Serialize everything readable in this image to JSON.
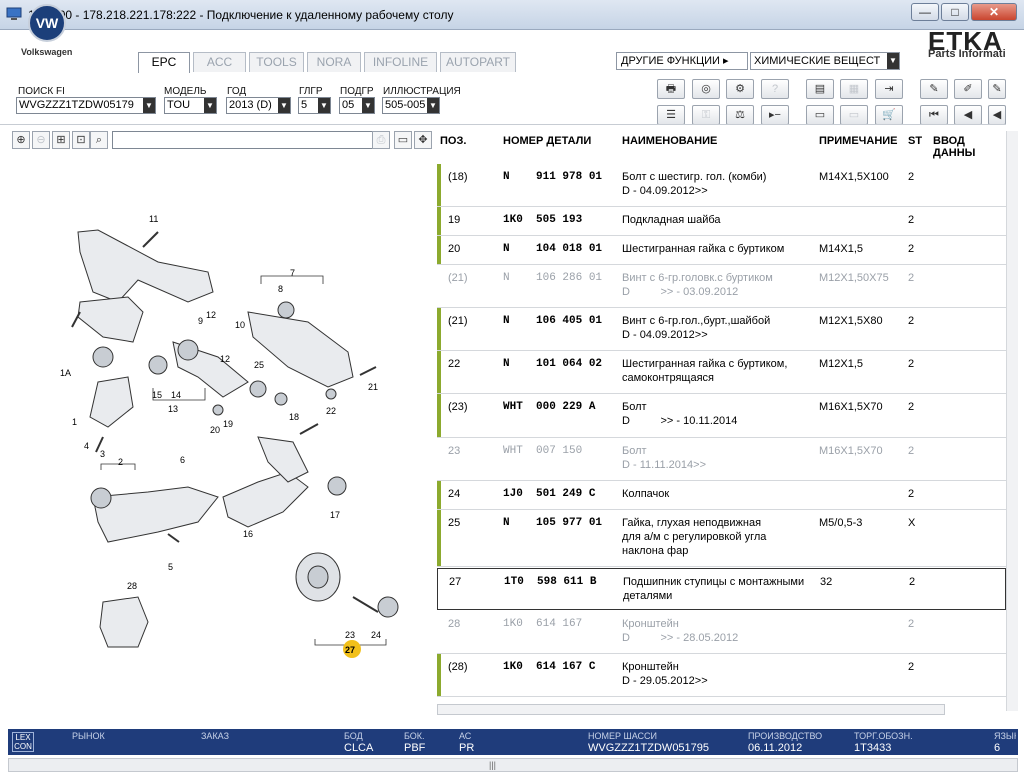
{
  "window": {
    "title": "151-300 - 178.218.221.178:222 - Подключение к удаленному рабочему столу",
    "minimize": "—",
    "maximize": "□",
    "close": "✕"
  },
  "brand": {
    "vw_logo": "VW",
    "vw_text": "Volkswagen",
    "etka": "ETKA",
    "etka_sub": "Parts Informati"
  },
  "tabs": [
    {
      "label": "EPC",
      "active": true
    },
    {
      "label": "ACC",
      "active": false
    },
    {
      "label": "TOOLS",
      "active": false
    },
    {
      "label": "NORA",
      "active": false
    },
    {
      "label": "INFOLINE",
      "active": false
    },
    {
      "label": "AUTOPART",
      "active": false
    }
  ],
  "functions": {
    "label": "ДРУГИЕ ФУНКЦИИ ▸",
    "selected": "ХИМИЧЕСКИЕ ВЕЩЕСТ"
  },
  "filters": {
    "search_label": "ПОИСК FI",
    "search_value": "WVGZZZ1TZDW05179",
    "model_label": "МОДЕЛЬ",
    "model_value": "TOU",
    "year_label": "ГОД",
    "year_value": "2013 (D)",
    "mg_label": "ГЛГР",
    "mg_value": "5",
    "sg_label": "ПОДГР",
    "sg_value": "05",
    "illus_label": "ИЛЛЮСТРАЦИЯ",
    "illus_value": "505-005"
  },
  "table": {
    "headers": {
      "pos": "ПОЗ.",
      "part": "НОМЕР ДЕТАЛИ",
      "name": "НАИМЕНОВАНИЕ",
      "note": "ПРИМЕЧАНИЕ",
      "st": "ST",
      "input": "ВВОД ДАННЫ"
    },
    "rows": [
      {
        "pos": "(18)",
        "part": "N    911 978 01",
        "name": "Болт с шестигр. гол. (комби)",
        "name2": "D - 04.09.2012>>",
        "note": "M14X1,5X100",
        "st": "2",
        "grey": false
      },
      {
        "pos": "19",
        "part": "1K0  505 193",
        "name": "Подкладная шайба",
        "name2": "",
        "note": "",
        "st": "2",
        "grey": false
      },
      {
        "pos": "20",
        "part": "N    104 018 01",
        "name": "Шестигранная гайка с буртиком",
        "name2": "",
        "note": "M14X1,5",
        "st": "2",
        "grey": false
      },
      {
        "pos": "(21)",
        "part": "N    106 286 01",
        "name": "Винт с 6-гр.головк.с буртиком",
        "name2": "D          >> - 03.09.2012",
        "note": "M12X1,50X75",
        "st": "2",
        "grey": true
      },
      {
        "pos": "(21)",
        "part": "N    106 405 01",
        "name": "Винт с 6-гр.гол.,бурт.,шайбой",
        "name2": "D - 04.09.2012>>",
        "note": "M12X1,5X80",
        "st": "2",
        "grey": false
      },
      {
        "pos": "22",
        "part": "N    101 064 02",
        "name": "Шестигранная гайка с буртиком,",
        "name2": "самоконтрящаяся",
        "note": "M12X1,5",
        "st": "2",
        "grey": false
      },
      {
        "pos": "(23)",
        "part": "WHT  000 229 A",
        "name": "Болт",
        "name2": "D          >> - 10.11.2014",
        "note": "M16X1,5X70",
        "st": "2",
        "grey": false
      },
      {
        "pos": "23",
        "part": "WHT  007 150",
        "name": "Болт",
        "name2": "D - 11.11.2014>>",
        "note": "M16X1,5X70",
        "st": "2",
        "grey": true
      },
      {
        "pos": "24",
        "part": "1J0  501 249 C",
        "name": "Колпачок",
        "name2": "",
        "note": "",
        "st": "2",
        "grey": false
      },
      {
        "pos": "25",
        "part": "N    105 977 01",
        "name": "Гайка, глухая неподвижная",
        "name2": "для а/м с регулировкой угла",
        "name3": "наклона фар",
        "note": "M5/0,5-3",
        "st": "X",
        "grey": false
      },
      {
        "pos": "27",
        "part": "1T0  598 611 B",
        "name": "Подшипник ступицы с монтажными",
        "name2": "деталями",
        "note": "32",
        "st": "2",
        "grey": false,
        "selected": true
      },
      {
        "pos": "28",
        "part": "1K0  614 167",
        "name": "Кронштейн",
        "name2": "D          >> - 28.05.2012",
        "note": "",
        "st": "2",
        "grey": true
      },
      {
        "pos": "(28)",
        "part": "1K0  614 167 C",
        "name": "Кронштейн",
        "name2": "D - 29.05.2012>>",
        "note": "",
        "st": "2",
        "grey": false
      }
    ]
  },
  "illustration": {
    "callouts": [
      "11",
      "7",
      "8",
      "1A",
      "12",
      "9",
      "10",
      "12",
      "25",
      "21",
      "15",
      "14",
      "13",
      "22",
      "1",
      "20",
      "19",
      "18",
      "4",
      "6",
      "3",
      "2",
      "17",
      "16",
      "5",
      "28",
      "23",
      "24",
      "27"
    ]
  },
  "status": {
    "lexcon": "LEX CON",
    "market_label": "РЫНОК",
    "order_label": "ЗАКАЗ",
    "bod_label": "БОД",
    "bod_value": "CLCA",
    "bok_label": "БОК.",
    "bok_value": "PBF",
    "ac_label": "АС",
    "ac_value": "PR",
    "chassis_label": "НОМЕР ШАССИ",
    "chassis_value": "WVGZZZ1TZDW051795",
    "prod_label": "ПРОИЗВОДСТВО",
    "prod_value": "06.11.2012",
    "trade_label": "ТОРГ.ОБОЗН.",
    "trade_value": "1T3433",
    "lang_label": "ЯЗЫК",
    "lang_value": "6"
  },
  "colors": {
    "accent": "#1f3c7b",
    "marker": "#8caa2e",
    "highlight": "#f2c01a"
  }
}
